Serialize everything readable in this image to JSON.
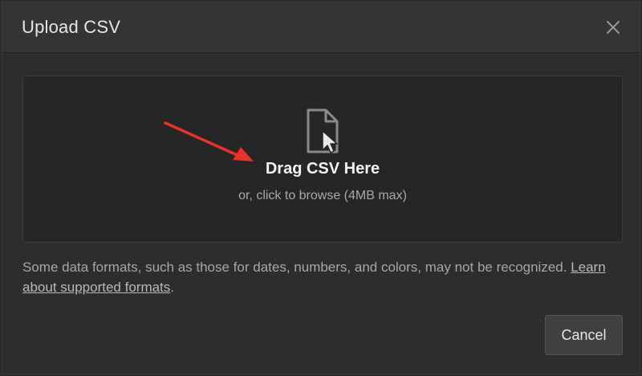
{
  "dialog": {
    "title": "Upload CSV",
    "close_icon": "close-icon"
  },
  "dropzone": {
    "icon": "file-upload-icon",
    "title": "Drag CSV Here",
    "subtitle": "or, click to browse (4MB max)"
  },
  "note": {
    "text": "Some data formats, such as those for dates, numbers, and colors, may not be recognized. ",
    "link": "Learn about supported formats",
    "end": "."
  },
  "footer": {
    "cancel_label": "Cancel"
  },
  "colors": {
    "annotation_arrow": "#e8322a",
    "background": "#2d2d2d",
    "dropzone": "#262626"
  }
}
